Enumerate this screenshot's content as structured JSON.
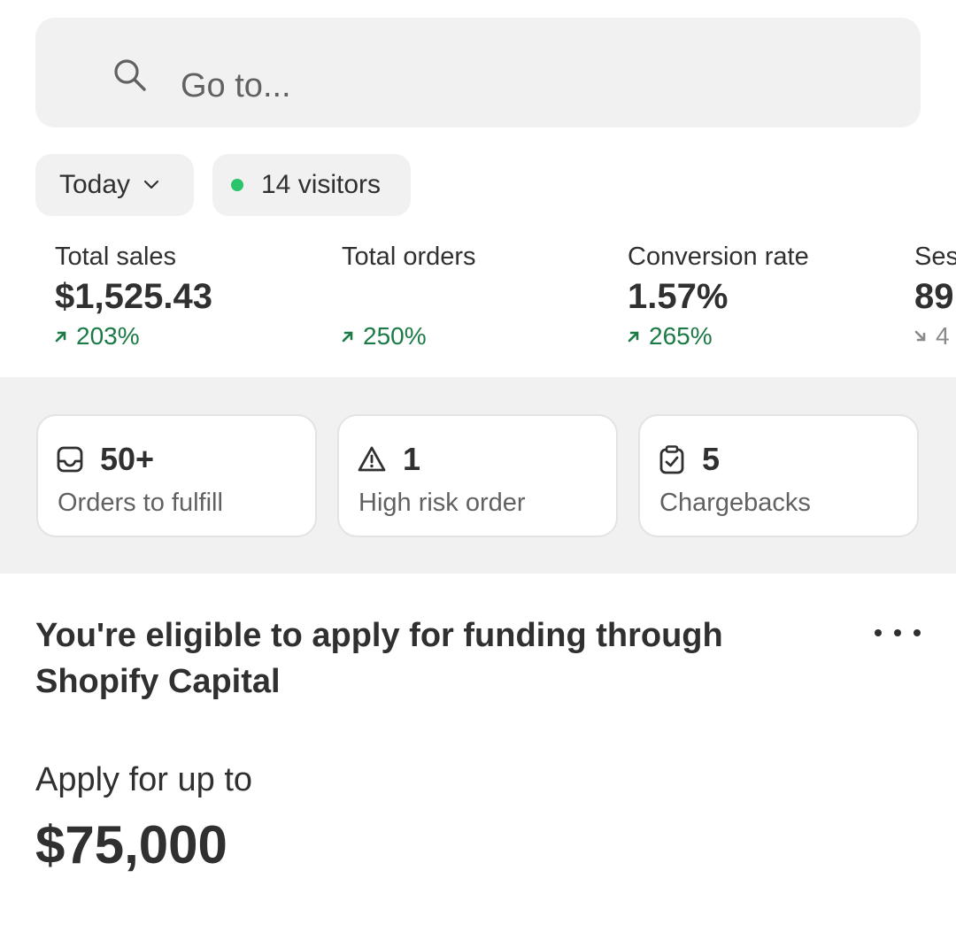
{
  "search": {
    "placeholder": "Go to..."
  },
  "filters": {
    "date_label": "Today",
    "visitors_label": "14 visitors",
    "live_dot_color": "#29c46b"
  },
  "metrics": [
    {
      "label": "Total sales",
      "value": "$1,525.43",
      "change": "203%",
      "trend": "up"
    },
    {
      "label": "Total orders",
      "value": "",
      "change": "250%",
      "trend": "up"
    },
    {
      "label": "Conversion rate",
      "value": "1.57%",
      "change": "265%",
      "trend": "up"
    },
    {
      "label": "Ses",
      "value": "89",
      "change": "4",
      "trend": "down"
    }
  ],
  "action_cards": [
    {
      "icon": "inbox-icon",
      "count": "50+",
      "label": "Orders to fulfill"
    },
    {
      "icon": "alert-triangle-icon",
      "count": "1",
      "label": "High risk order"
    },
    {
      "icon": "clipboard-check-icon",
      "count": "5",
      "label": "Chargebacks"
    }
  ],
  "capital": {
    "title": "You're eligible to apply for funding through Shopify Capital",
    "apply_label": "Apply for up to",
    "amount": "$75,000"
  },
  "colors": {
    "positive": "#1b7a45",
    "neutral_bg": "#f1f1f1",
    "text": "#303030"
  }
}
